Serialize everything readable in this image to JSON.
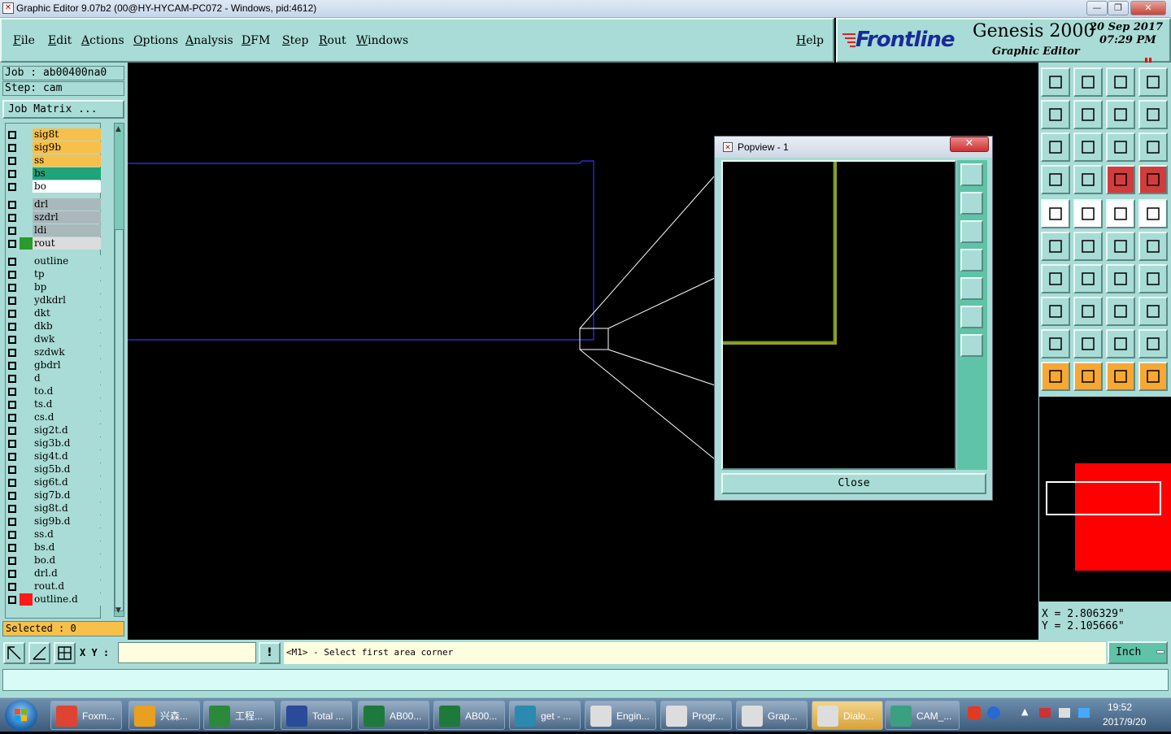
{
  "window": {
    "title": "Graphic Editor 9.07b2 (00@HY-HYCAM-PC072 - Windows, pid:4612)",
    "min": "—",
    "max": "❐",
    "close": "✕"
  },
  "menu": {
    "items": [
      "File",
      "Edit",
      "Actions",
      "Options",
      "Analysis",
      "DFM",
      "Step",
      "Rout",
      "Windows"
    ],
    "help": "Help"
  },
  "brand": {
    "logo": "Frontline",
    "product": "Genesis 2000",
    "subtitle": "Graphic Editor",
    "date": "20 Sep 2017",
    "time": "07:29 PM"
  },
  "job": {
    "job_label": "Job : ab00400na0",
    "step_label": "Step: cam",
    "matrix_button": "Job Matrix ..."
  },
  "layers": [
    {
      "name": "sig8t",
      "color": "#f7c04a"
    },
    {
      "name": "sig9b",
      "color": "#f7c04a"
    },
    {
      "name": "ss",
      "color": "#f7c04a"
    },
    {
      "name": "bs",
      "color": "#1fa37a"
    },
    {
      "name": "bo",
      "color": "#ffffff"
    },
    {
      "name": "drl",
      "color": "#aab8bc"
    },
    {
      "name": "szdrl",
      "color": "#aab8bc"
    },
    {
      "name": "ldi",
      "color": "#aab8bc"
    },
    {
      "name": "rout",
      "color": "#dcdcdc",
      "swatch": "#2a9a2a"
    },
    {
      "name": "outline",
      "color": "#a9dcd6"
    },
    {
      "name": "tp",
      "color": "#a9dcd6"
    },
    {
      "name": "bp",
      "color": "#a9dcd6"
    },
    {
      "name": "ydkdrl",
      "color": "#a9dcd6"
    },
    {
      "name": "dkt",
      "color": "#a9dcd6"
    },
    {
      "name": "dkb",
      "color": "#a9dcd6"
    },
    {
      "name": "dwk",
      "color": "#a9dcd6"
    },
    {
      "name": "szdwk",
      "color": "#a9dcd6"
    },
    {
      "name": "gbdrl",
      "color": "#a9dcd6"
    },
    {
      "name": "d",
      "color": "#a9dcd6"
    },
    {
      "name": "to.d",
      "color": "#a9dcd6"
    },
    {
      "name": "ts.d",
      "color": "#a9dcd6"
    },
    {
      "name": "cs.d",
      "color": "#a9dcd6"
    },
    {
      "name": "sig2t.d",
      "color": "#a9dcd6"
    },
    {
      "name": "sig3b.d",
      "color": "#a9dcd6"
    },
    {
      "name": "sig4t.d",
      "color": "#a9dcd6"
    },
    {
      "name": "sig5b.d",
      "color": "#a9dcd6"
    },
    {
      "name": "sig6t.d",
      "color": "#a9dcd6"
    },
    {
      "name": "sig7b.d",
      "color": "#a9dcd6"
    },
    {
      "name": "sig8t.d",
      "color": "#a9dcd6"
    },
    {
      "name": "sig9b.d",
      "color": "#a9dcd6"
    },
    {
      "name": "ss.d",
      "color": "#a9dcd6"
    },
    {
      "name": "bs.d",
      "color": "#a9dcd6"
    },
    {
      "name": "bo.d",
      "color": "#a9dcd6"
    },
    {
      "name": "drl.d",
      "color": "#a9dcd6"
    },
    {
      "name": "rout.d",
      "color": "#a9dcd6"
    },
    {
      "name": "outline.d",
      "color": "#a9dcd6",
      "swatch": "#ff1a1a"
    }
  ],
  "selected": "Selected : 0",
  "popview": {
    "title": "Popview - 1",
    "close_x": "✕",
    "close_button": "Close"
  },
  "coords": {
    "x": "X = 2.806329\"",
    "y": "Y = 2.105666\""
  },
  "cmd": {
    "xy_label": "X Y :",
    "bang": "!",
    "prompt": "<M1> - Select first area corner",
    "unit": "Inch"
  },
  "taskbar": {
    "tasks": [
      "Foxm...",
      "兴森...",
      "工程...",
      "Total ...",
      "AB00...",
      "AB00...",
      "get - ...",
      "Engin...",
      "Progr...",
      "Grap...",
      "Dialo...",
      "CAM_..."
    ],
    "clock_time": "19:52",
    "clock_date": "2017/9/20"
  },
  "colors": {
    "panel": "#a9dcd6",
    "accent": "#5fc3a7",
    "layer_yellow": "#f7c04a",
    "outline_blue": "#3333ff"
  }
}
